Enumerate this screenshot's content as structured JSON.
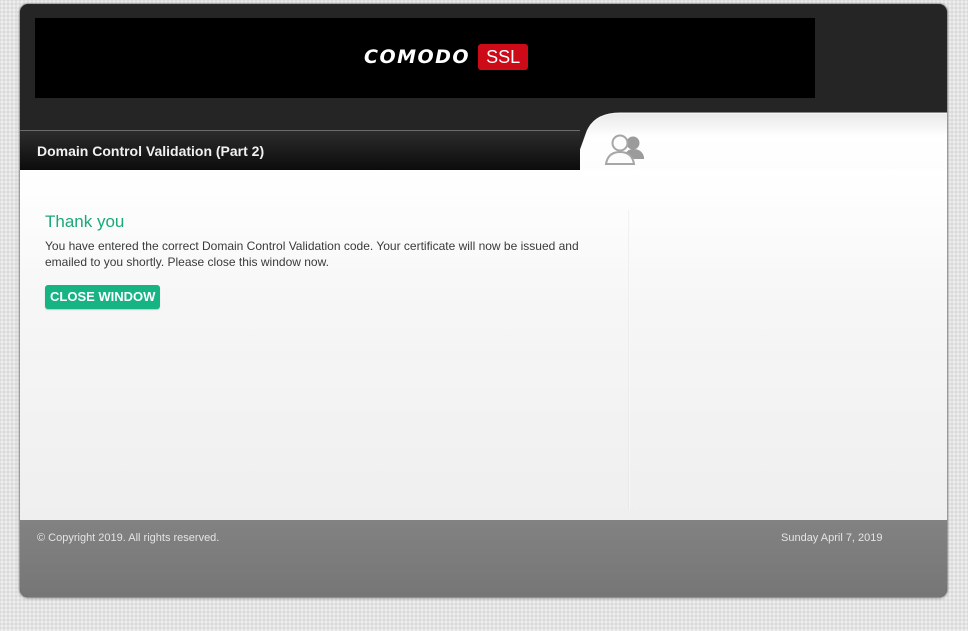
{
  "brand": {
    "logo_word": "COMODO",
    "logo_badge": "SSL",
    "badge_color": "#cc0a18"
  },
  "header": {
    "title": "Domain Control Validation (Part 2)",
    "user_icon": "people-icon"
  },
  "main": {
    "heading": "Thank you",
    "message": "You have entered the correct Domain Control Validation code. Your certificate will now be issued and emailed to you shortly. Please close this window now.",
    "close_button_label": "CLOSE WINDOW",
    "accent_color": "#16b383"
  },
  "footer": {
    "copyright": "© Copyright 2019. All rights reserved.",
    "date": "Sunday April 7, 2019"
  }
}
